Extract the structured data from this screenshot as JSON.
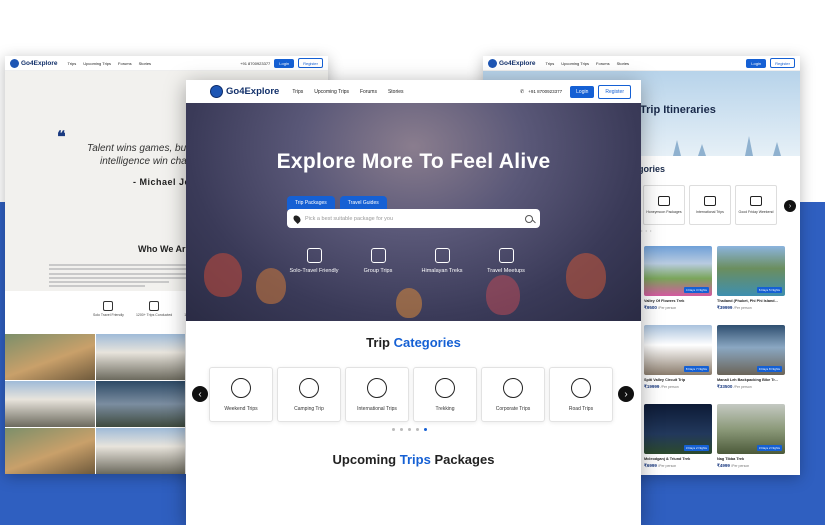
{
  "brand": {
    "name": "Go4Explore",
    "accent": "#1560d4",
    "navy": "#12306a",
    "backdrop": "#2f5fc0"
  },
  "nav": {
    "links": [
      "Trips",
      "Upcoming Trips",
      "Forums",
      "Stories"
    ],
    "phone": "+91 8700923377",
    "login": "Login",
    "register": "Register"
  },
  "left_page": {
    "quote_line1": "Talent wins games, but",
    "quote_line2": "intelligence win chan",
    "author": "- Michael Jor",
    "about_title": "Who We Ar",
    "stats": [
      "Solo Travel Friendly",
      "1200+ Trips Conducted",
      "1k+ Trave"
    ]
  },
  "right_page": {
    "hero_title": "Trip Itineraries",
    "categories_title": "egories",
    "categories": [
      "Honeymoon Packages",
      "International Trips",
      "Good Friday Weekend"
    ],
    "cards": [
      {
        "name": "Valley Of Flowers Trek",
        "price": "₹9500",
        "per": "/Per person",
        "badge": "4 Days 3 Nights"
      },
      {
        "name": "Thailand (Phuket, Phi Phi Island...",
        "price": "₹39999",
        "per": "/Per person",
        "badge": "6 Days 5 Nights"
      },
      {
        "name": "Spiti Valley Circuit Trip",
        "price": "₹19999",
        "per": "/Per person",
        "badge": "8 Days 7 Nights"
      },
      {
        "name": "Manali Leh Backpacking Bike Tr...",
        "price": "₹33500",
        "per": "/Per person",
        "badge": "9 Days 8 Nights"
      },
      {
        "name": "Mcleodganj & Triund Trek",
        "price": "₹6999",
        "per": "/Per person",
        "badge": "3 Days 2 Nights"
      },
      {
        "name": "Nag Tibba Trek",
        "price": "₹4999",
        "per": "/Per person",
        "badge": "3 Days 2 Nights"
      }
    ]
  },
  "hero": {
    "title": "Explore More To Feel Alive",
    "tab_packages": "Trip Packages",
    "tab_guides": "Travel Guides",
    "search_placeholder": "Pick a best suitable package for you",
    "categories": [
      "Solo-Travel Friendly",
      "Group Trips",
      "Himalayan Treks",
      "Travel Meetups"
    ]
  },
  "trip_categories": {
    "title_part1": "Trip",
    "title_part2": "Categories",
    "items": [
      "Weekend Trips",
      "Camping Trip",
      "International Trips",
      "Trekking",
      "Corporate Trips",
      "Road Trips"
    ]
  },
  "upcoming": {
    "title_part1": "Upcoming",
    "title_part2": "Trips",
    "title_part3": "Packages"
  }
}
